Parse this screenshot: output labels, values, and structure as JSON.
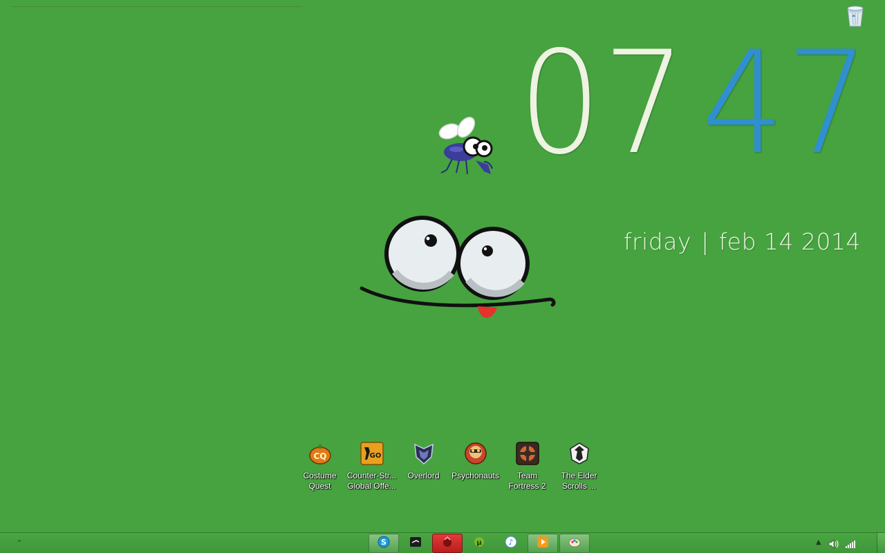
{
  "clock": {
    "hours": "07",
    "minutes": "47"
  },
  "date": {
    "weekday": "friday",
    "separator": "|",
    "day": "feb 14 2014"
  },
  "desktop_icons": [
    {
      "label": "Costume Quest",
      "icon": "costume-quest-icon"
    },
    {
      "label": "Counter-Str... Global Offe...",
      "icon": "csgo-icon"
    },
    {
      "label": "Overlord",
      "icon": "overlord-icon"
    },
    {
      "label": "Psychonauts",
      "icon": "psychonauts-icon"
    },
    {
      "label": "Team Fortress 2",
      "icon": "team-fortress-icon"
    },
    {
      "label": "The Elder Scrolls ...",
      "icon": "elder-scrolls-icon"
    }
  ],
  "taskbar": {
    "apps": [
      {
        "name": "skype",
        "icon": "skype-icon",
        "state": "active"
      },
      {
        "name": "steam",
        "icon": "steam-icon",
        "state": "normal"
      },
      {
        "name": "app-red",
        "icon": "red-app-icon",
        "state": "highlight"
      },
      {
        "name": "utorrent",
        "icon": "utorrent-icon",
        "state": "normal"
      },
      {
        "name": "itunes",
        "icon": "itunes-icon",
        "state": "normal"
      },
      {
        "name": "media-player",
        "icon": "media-player-icon",
        "state": "active"
      },
      {
        "name": "paint",
        "icon": "paint-icon",
        "state": "active"
      }
    ],
    "tray_icons": [
      "show-hidden-icons-icon",
      "volume-icon",
      "network-icon"
    ]
  },
  "colors": {
    "background": "#46a340",
    "clock_hours": "#eef3e2",
    "clock_minutes": "#2f8fcf"
  }
}
